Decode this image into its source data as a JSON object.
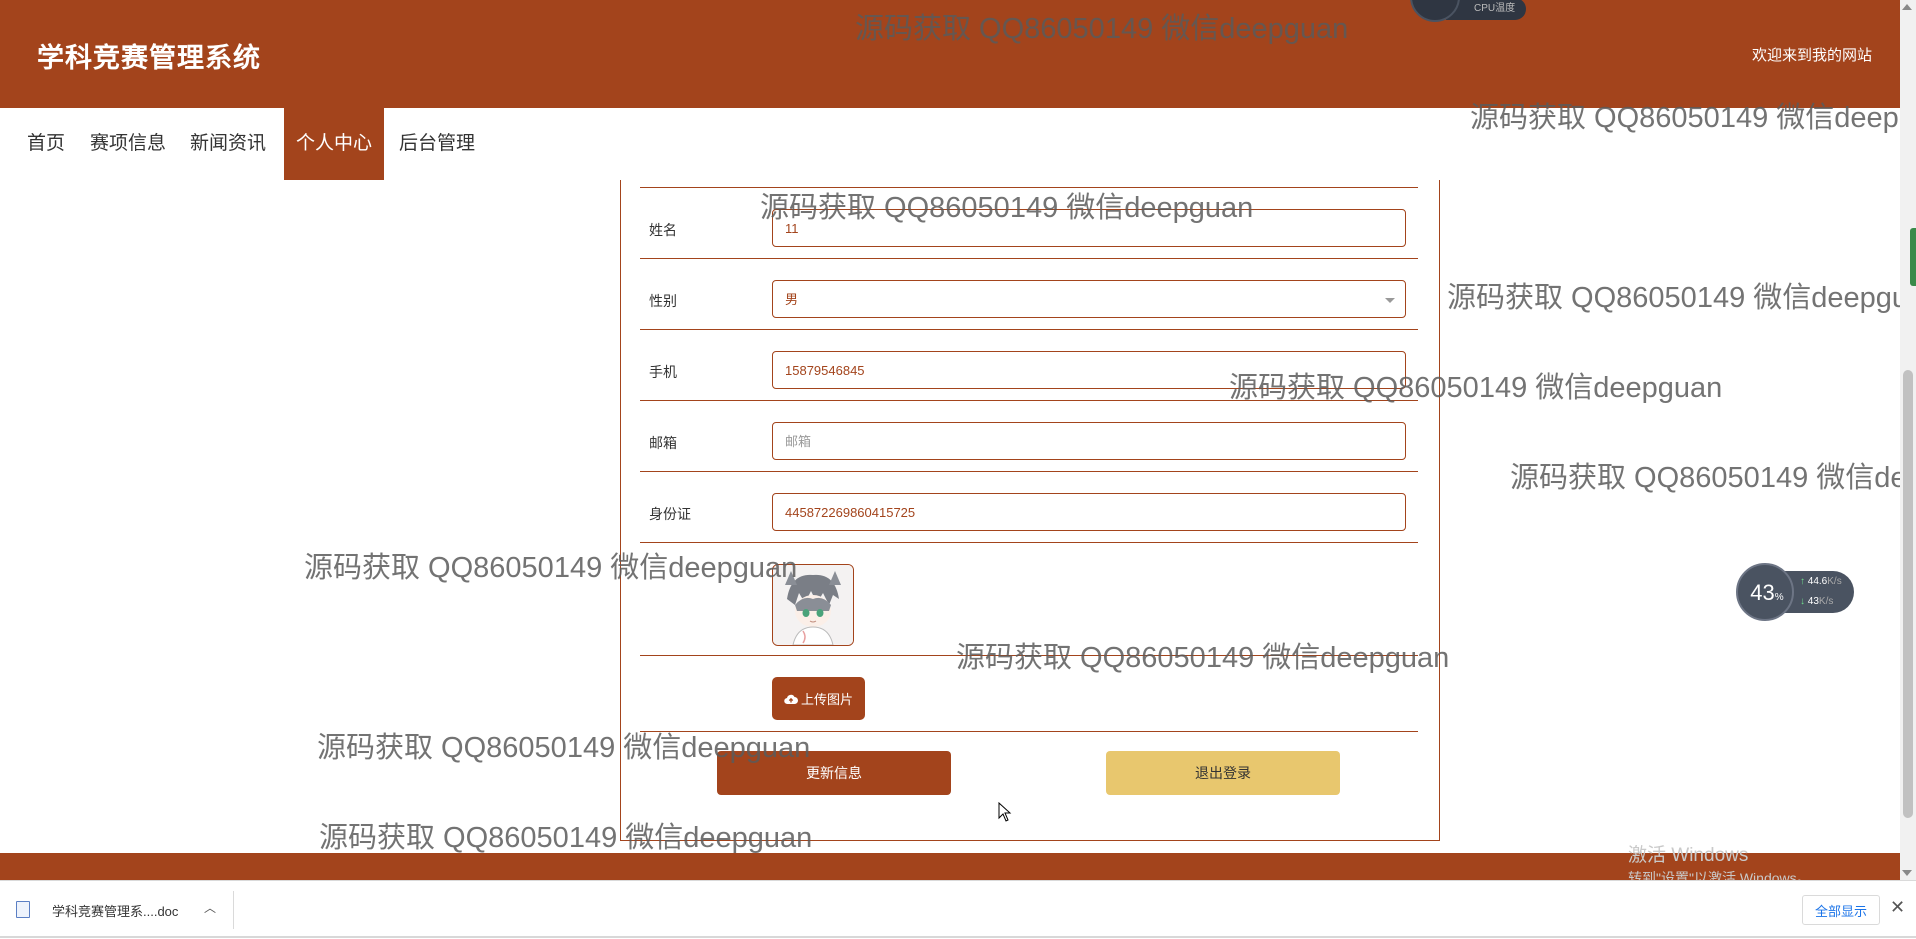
{
  "header": {
    "title": "学科竞赛管理系统",
    "welcome": "欢迎来到我的网站"
  },
  "nav": {
    "items": [
      {
        "label": "首页"
      },
      {
        "label": "赛项信息"
      },
      {
        "label": "新闻资讯"
      },
      {
        "label": "个人中心",
        "active": true
      },
      {
        "label": "后台管理"
      }
    ]
  },
  "form": {
    "name": {
      "label": "姓名",
      "value": "11"
    },
    "gender": {
      "label": "性别",
      "value": "男"
    },
    "phone": {
      "label": "手机",
      "value": "15879546845"
    },
    "email": {
      "label": "邮箱",
      "placeholder": "邮箱"
    },
    "idcard": {
      "label": "身份证",
      "value": "445872269860415725"
    },
    "upload_label": "上传图片",
    "update_label": "更新信息",
    "logout_label": "退出登录"
  },
  "download_bar": {
    "file_name": "学科竞赛管理系....doc",
    "show_all": "全部显示"
  },
  "system": {
    "activate_title": "激活 Windows",
    "activate_sub": "转到\"设置\"以激活 Windows。",
    "cpu_label": "CPU温度",
    "speed_percent": "43",
    "speed_up": "44.6",
    "speed_down": "43",
    "speed_unit": "K/s"
  },
  "watermark_text": "源码获取 QQ86050149 微信deepguan",
  "colors": {
    "brand": "#a3441c",
    "logout": "#e8c76e"
  }
}
